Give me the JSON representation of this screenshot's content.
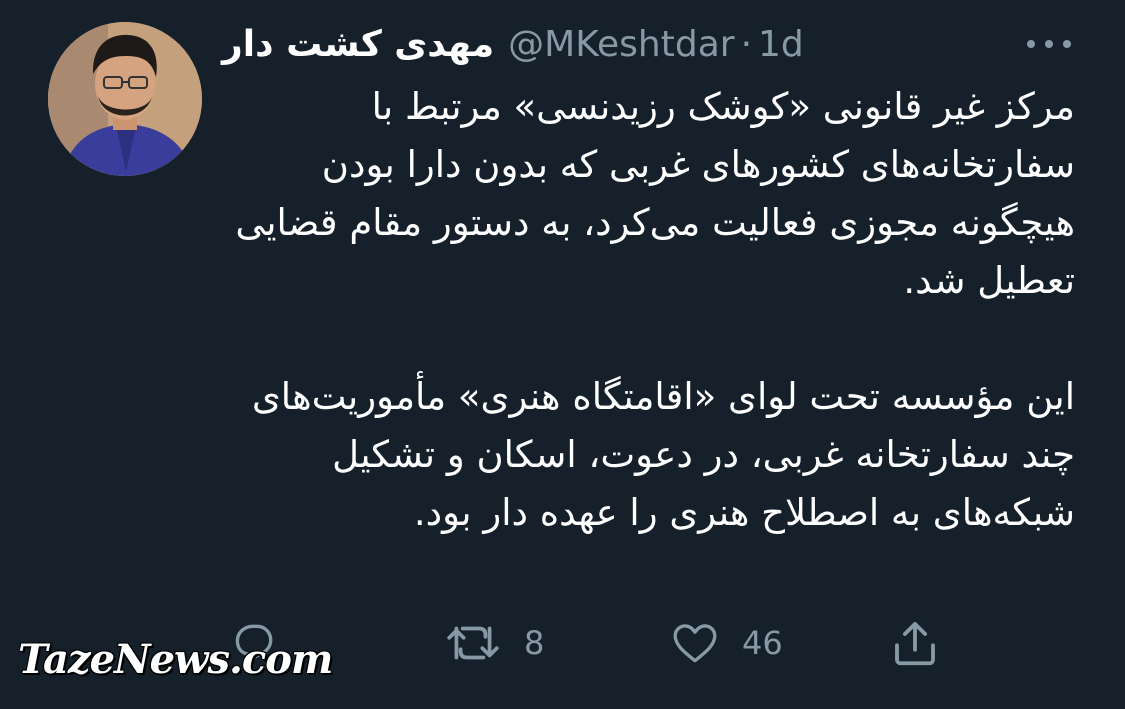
{
  "tweet": {
    "author": {
      "display_name": "مهدی کشت دار",
      "handle": "@MKeshtdar",
      "avatar": "profile-photo"
    },
    "separator": "·",
    "time": "1d",
    "more_icon": "more-horizontal-icon",
    "paragraphs": [
      "مرکز غیر قانونی «کوشک رزیدنسی» مرتبط با سفارتخانه‌های کشورهای غربی که بدون دارا بودن هیچگونه مجوزی فعالیت می‌کرد، به دستور مقام قضایی تعطیل شد.",
      "این مؤسسه تحت لوای «اقامتگاه هنری» مأموریت‌های چند سفارتخانه غربی، در دعوت، اسکان و تشکیل شبکه‌های به اصطلاح هنری را عهده دار بود."
    ],
    "actions": {
      "reply": {
        "icon": "reply-icon",
        "count": ""
      },
      "retweet": {
        "icon": "retweet-icon",
        "count": "8"
      },
      "like": {
        "icon": "heart-icon",
        "count": "46"
      },
      "share": {
        "icon": "share-icon"
      }
    }
  },
  "watermark": "TazeNews.com",
  "colors": {
    "background": "#15202b",
    "text": "#ffffff",
    "secondary": "#8899a6"
  }
}
